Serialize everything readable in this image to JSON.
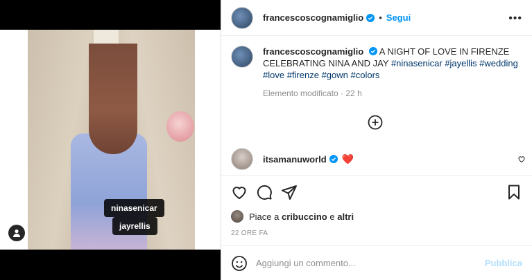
{
  "media": {
    "tags": [
      "ninasenicar",
      "jayrellis"
    ]
  },
  "header": {
    "username": "francescoscognamiglio",
    "separator": "•",
    "follow_label": "Segui",
    "more_label": "•••"
  },
  "caption": {
    "username": "francescoscognamiglio",
    "text": "A NIGHT OF LOVE IN FIRENZE CELEBRATING NINA AND JAY",
    "hashtags": [
      "#ninasenicar",
      "#jayellis",
      "#wedding",
      "#love",
      "#firenze",
      "#gown",
      "#colors"
    ],
    "edited": "Elemento modificato · 22 h"
  },
  "comments": [
    {
      "username": "itsamanuworld",
      "text": "❤️"
    }
  ],
  "likes": {
    "prefix": "Piace a",
    "user": "cribuccino",
    "conj": "e",
    "others": "altri"
  },
  "time_label": "22 ORE FA",
  "add_comment": {
    "placeholder": "Aggiungi un commento...",
    "publish_label": "Pubblica"
  },
  "colors": {
    "accent": "#0095f6",
    "hashtag": "#00376b",
    "muted": "#8e8e8e",
    "publish_disabled": "#b2dffc",
    "heart": "#ed4956"
  },
  "icons": [
    "verified-badge-icon",
    "more-icon",
    "user-tag-icon",
    "plus-circle-icon",
    "heart-icon",
    "comment-icon",
    "share-icon",
    "bookmark-icon",
    "emoji-icon"
  ]
}
